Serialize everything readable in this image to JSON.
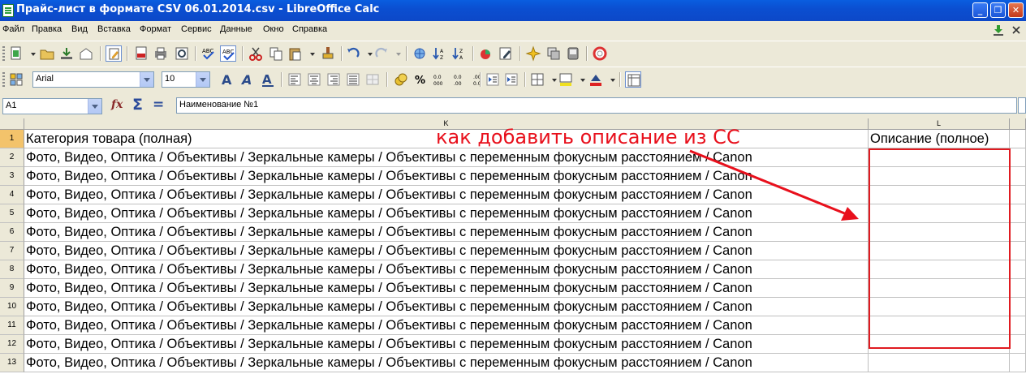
{
  "window": {
    "title": "Прайс-лист в формате CSV 06.01.2014.csv - LibreOffice Calc",
    "minimize_glyph": "_",
    "maximize_glyph": "❐",
    "close_glyph": "✕"
  },
  "menu": {
    "items": [
      {
        "label": "Файл",
        "accel": "Ф"
      },
      {
        "label": "Правка",
        "accel": "П"
      },
      {
        "label": "Вид",
        "accel": "В"
      },
      {
        "label": "Вставка",
        "accel": "В"
      },
      {
        "label": "Формат",
        "accel": "Ф"
      },
      {
        "label": "Сервис",
        "accel": "С"
      },
      {
        "label": "Данные",
        "accel": "Д"
      },
      {
        "label": "Окно",
        "accel": "О"
      },
      {
        "label": "Справка",
        "accel": "С"
      }
    ]
  },
  "toolbar": {
    "font_name": "Arial",
    "font_size": "10",
    "bold_a": "A",
    "percent": "%"
  },
  "formula_bar": {
    "name_box": "A1",
    "fx_glyph": "fx",
    "sum_glyph": "Σ",
    "equals_glyph": "=",
    "content": "Наименование №1"
  },
  "sheet": {
    "columns": [
      {
        "id": "K"
      },
      {
        "id": "L"
      }
    ],
    "header_row": {
      "row_num": "1",
      "k": "Категория товара (полная)",
      "l": "Описание (полное)"
    },
    "rows": [
      {
        "row_num": "2",
        "k": "Фото, Видео, Оптика / Объективы / Зеркальные камеры / Объективы с переменным фокусным расстоянием / Canon",
        "l": ""
      },
      {
        "row_num": "3",
        "k": "Фото, Видео, Оптика / Объективы / Зеркальные камеры / Объективы с переменным фокусным расстоянием / Canon",
        "l": ""
      },
      {
        "row_num": "4",
        "k": "Фото, Видео, Оптика / Объективы / Зеркальные камеры / Объективы с переменным фокусным расстоянием / Canon",
        "l": ""
      },
      {
        "row_num": "5",
        "k": "Фото, Видео, Оптика / Объективы / Зеркальные камеры / Объективы с переменным фокусным расстоянием / Canon",
        "l": ""
      },
      {
        "row_num": "6",
        "k": "Фото, Видео, Оптика / Объективы / Зеркальные камеры / Объективы с переменным фокусным расстоянием / Canon",
        "l": ""
      },
      {
        "row_num": "7",
        "k": "Фото, Видео, Оптика / Объективы / Зеркальные камеры / Объективы с переменным фокусным расстоянием / Canon",
        "l": ""
      },
      {
        "row_num": "8",
        "k": "Фото, Видео, Оптика / Объективы / Зеркальные камеры / Объективы с переменным фокусным расстоянием / Canon",
        "l": ""
      },
      {
        "row_num": "9",
        "k": "Фото, Видео, Оптика / Объективы / Зеркальные камеры / Объективы с переменным фокусным расстоянием / Canon",
        "l": ""
      },
      {
        "row_num": "10",
        "k": "Фото, Видео, Оптика / Объективы / Зеркальные камеры / Объективы с переменным фокусным расстоянием / Canon",
        "l": ""
      },
      {
        "row_num": "11",
        "k": "Фото, Видео, Оптика / Объективы / Зеркальные камеры / Объективы с переменным фокусным расстоянием / Canon",
        "l": ""
      },
      {
        "row_num": "12",
        "k": "Фото, Видео, Оптика / Объективы / Зеркальные камеры / Объективы с переменным фокусным расстоянием / Canon",
        "l": ""
      },
      {
        "row_num": "13",
        "k": "Фото, Видео, Оптика / Объективы / Зеркальные камеры / Объективы с переменным фокусным расстоянием / Canon",
        "l": ""
      }
    ]
  },
  "annotation": {
    "text": "как добавить описание из СС",
    "color": "#e8101c"
  },
  "colors": {
    "titlebar": "#0b4fd1",
    "chrome": "#ece9d8",
    "active_row_header": "#f3c36b",
    "annotation_red": "#e01a20"
  },
  "icons": {
    "toolbar1": [
      "new-document-icon",
      "open-icon",
      "save-icon",
      "email-icon",
      "edit-file-icon",
      "export-pdf-icon",
      "print-icon",
      "print-preview-icon",
      "spellcheck-icon",
      "autospellcheck-icon",
      "cut-icon",
      "copy-icon",
      "paste-icon",
      "format-paintbrush-icon",
      "undo-icon",
      "redo-icon",
      "hyperlink-icon",
      "sort-ascending-icon",
      "sort-descending-icon",
      "chart-icon",
      "pivot-icon",
      "navigator-icon",
      "gallery-icon",
      "data-sources-icon",
      "help-icon"
    ],
    "toolbar2": [
      "styles-icon",
      "bold-icon",
      "italic-icon",
      "underline-icon",
      "align-left-icon",
      "align-center-icon",
      "align-right-icon",
      "justify-icon",
      "merge-cells-icon",
      "currency-icon",
      "percent-icon",
      "standard-format-icon",
      "add-decimal-icon",
      "delete-decimal-icon",
      "decrease-indent-icon",
      "increase-indent-icon",
      "borders-icon",
      "background-color-icon",
      "font-color-icon",
      "toggle-grid-icon"
    ]
  }
}
